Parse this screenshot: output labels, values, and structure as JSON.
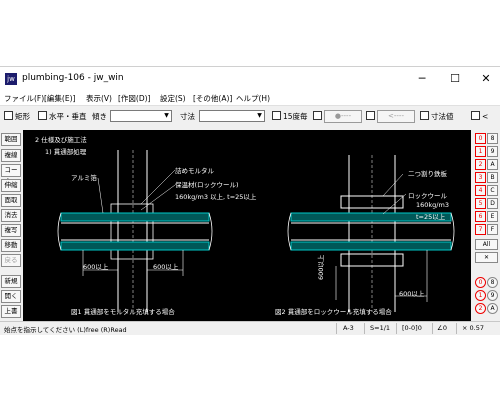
{
  "window": {
    "title": "plumbing-106 - jw_win",
    "icon_label": "jw"
  },
  "window_controls": {
    "minimize": "─",
    "maximize": "☐",
    "close": "✕"
  },
  "menu": [
    "ファイル(F)",
    "[編集(E)]",
    "表示(V)",
    "[作図(D)]",
    "設定(S)",
    "[その他(A)]",
    "ヘルプ(H)"
  ],
  "toolbar": {
    "rect": "矩形",
    "horiz_vert": "水平・垂直",
    "slope": "傾き",
    "dim": "寸法",
    "deg15": "15度毎",
    "btn1": "●----",
    "btn2": "<----",
    "dim_value": "寸法値",
    "lt": "<"
  },
  "left_tools": [
    "範囲",
    "複線",
    "コーナー",
    "伸縮",
    "面取",
    "消去",
    "複写",
    "移動",
    "戻る",
    "新規",
    "開く",
    "上書"
  ],
  "right_tools": {
    "red_numbers": [
      "0",
      "1",
      "2",
      "3",
      "4",
      "5",
      "6",
      "7"
    ],
    "letters": [
      "8",
      "A",
      "B",
      "C",
      "D",
      "E",
      "F"
    ],
    "all": "All",
    "x": "✕",
    "bottom_red": [
      "0",
      "1",
      "2"
    ],
    "bottom_right": [
      "8",
      "9",
      "A"
    ]
  },
  "drawing": {
    "heading": "2 仕様及び施工法",
    "subheading": "1) 貫通部処理",
    "label_alumi": "アルミ箔",
    "label_mortar": "詰めモルタル",
    "label_insul": "保温材(ロックウール)",
    "label_density1": "160kg/m3 以上, t=25以上",
    "dim_600_a": "600以上",
    "dim_600_b": "600以上",
    "caption1": "図1  貫通部をモルタル充填する場合",
    "label_nitowari": "二つ割り鉄板",
    "label_rockwool": "ロックウール",
    "label_density2": "160kg/m3",
    "label_t25": "t=25以上",
    "dim_v600": "600以上",
    "dim_600_c": "600以上",
    "caption2": "図2  貫通部をロックウール充填する場合"
  },
  "status": {
    "message": "始点を指示してください (L)free (R)Read",
    "sheet": "A-3",
    "scale": "S=1/1",
    "layer": "[0-0]0",
    "angle": "∠0",
    "zoom": "× 0.57"
  },
  "colors": {
    "canvas_bg": "#000000",
    "pipe": "#00c8c8",
    "wall": "#ffffff",
    "dim": "#ffffff",
    "accent_red": "#e00000"
  }
}
